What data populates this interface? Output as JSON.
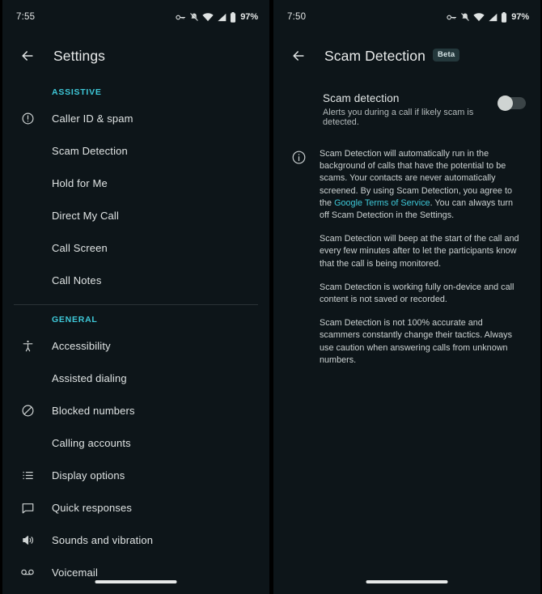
{
  "left_phone": {
    "status_bar": {
      "time": "7:55",
      "battery_percent": "97%",
      "icons": [
        "key-icon",
        "vibrate-off-icon",
        "wifi-icon",
        "cellular-signal-icon",
        "battery-icon"
      ]
    },
    "app_bar": {
      "back_label": "back-arrow",
      "title": "Settings"
    },
    "sections": [
      {
        "label": "ASSISTIVE",
        "items": [
          {
            "icon": "error-circle-icon",
            "label": "Caller ID & spam"
          },
          {
            "icon": "none",
            "label": "Scam Detection"
          },
          {
            "icon": "none",
            "label": "Hold for Me"
          },
          {
            "icon": "none",
            "label": "Direct My Call"
          },
          {
            "icon": "none",
            "label": "Call Screen"
          },
          {
            "icon": "none",
            "label": "Call Notes"
          }
        ]
      },
      {
        "label": "GENERAL",
        "items": [
          {
            "icon": "accessibility-icon",
            "label": "Accessibility"
          },
          {
            "icon": "none",
            "label": "Assisted dialing"
          },
          {
            "icon": "block-icon",
            "label": "Blocked numbers"
          },
          {
            "icon": "none",
            "label": "Calling accounts"
          },
          {
            "icon": "list-icon",
            "label": "Display options"
          },
          {
            "icon": "chat-bubble-icon",
            "label": "Quick responses"
          },
          {
            "icon": "volume-up-icon",
            "label": "Sounds and vibration"
          },
          {
            "icon": "voicemail-icon",
            "label": "Voicemail"
          }
        ]
      }
    ]
  },
  "right_phone": {
    "status_bar": {
      "time": "7:50",
      "battery_percent": "97%",
      "icons": [
        "key-icon",
        "vibrate-off-icon",
        "wifi-icon",
        "cellular-signal-icon",
        "battery-icon"
      ]
    },
    "app_bar": {
      "back_label": "back-arrow",
      "title": "Scam Detection",
      "badge": "Beta"
    },
    "toggle": {
      "title": "Scam detection",
      "subtitle": "Alerts you during a call if likely scam is detected.",
      "state": "off"
    },
    "info": {
      "paragraph_1_part_1": "Scam Detection will automatically run in the background of calls that have the potential to be scams. Your contacts are never automatically screened. By using Scam Detection, you agree to the ",
      "paragraph_1_link": "Google Terms of Service",
      "paragraph_1_part_2": ". You can always turn off Scam Detection in the Settings.",
      "paragraph_2": "Scam Detection will beep at the start of the call and every few minutes after to let the participants know that the call is being monitored.",
      "paragraph_3": "Scam Detection is working fully on-device and call content is not saved or recorded.",
      "paragraph_4": "Scam Detection is not 100% accurate and scammers constantly change their tactics. Always use caution when answering calls from unknown numbers."
    }
  },
  "colors": {
    "background": "#0d1519",
    "accent": "#3ec8d8",
    "text_primary": "#dfe3e3",
    "text_secondary": "#b3babb",
    "divider": "#2b3337",
    "badge_bg": "#24383c"
  }
}
